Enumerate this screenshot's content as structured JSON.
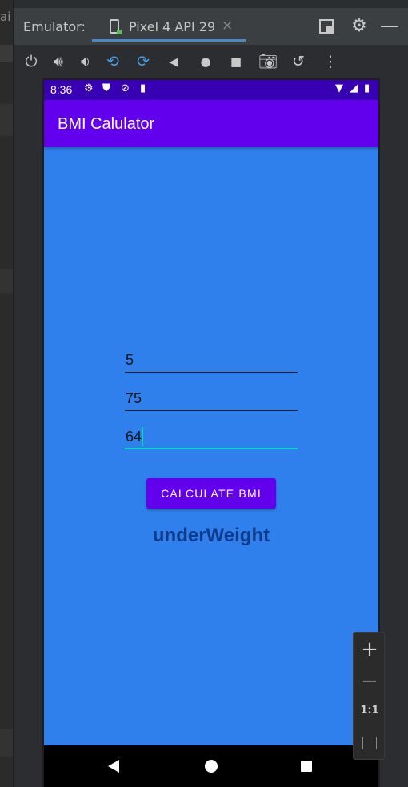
{
  "ide": {
    "left_fragment": "ai"
  },
  "emulator": {
    "label": "Emulator:",
    "device_tab": {
      "label": "Pixel 4 API 29",
      "close": "×"
    },
    "window_buttons": {
      "settings": "gear-icon",
      "minimize": "—"
    },
    "toolbar": [
      "power-icon",
      "volume-up-icon",
      "volume-down-icon",
      "rotate-left-icon",
      "rotate-right-icon",
      "back-icon",
      "home-icon",
      "overview-icon",
      "screenshot-icon",
      "snapshot-icon",
      "more-icon"
    ]
  },
  "phone": {
    "status": {
      "time": "8:36"
    },
    "app_title": "BMI Calulator",
    "inputs": [
      "5",
      "75",
      "64"
    ],
    "button_label": "CALCULATE BMI",
    "result": "underWeight",
    "colors": {
      "status_bar": "#3700b3",
      "app_bar": "#6200ee",
      "background": "#2f80ed",
      "accent": "#03dac5",
      "result_text": "#0d3c8c"
    }
  },
  "zoom": {
    "plus": "+",
    "minus": "−",
    "ratio": "1:1"
  }
}
